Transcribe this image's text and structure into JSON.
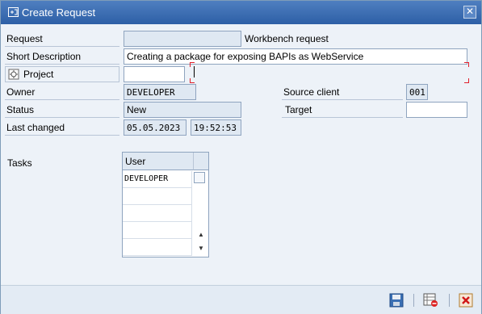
{
  "window": {
    "title": "Create Request",
    "close_label": "✕"
  },
  "form": {
    "request_label": "Request",
    "request_value": "",
    "request_type": "Workbench request",
    "short_desc_label": "Short Description",
    "short_desc_value": "Creating a package for exposing BAPIs as WebService",
    "project_label": "Project",
    "project_value": "",
    "owner_label": "Owner",
    "owner_value": "DEVELOPER",
    "status_label": "Status",
    "status_value": "New",
    "last_changed_label": "Last changed",
    "last_changed_date": "05.05.2023",
    "last_changed_time": "19:52:53",
    "source_client_label": "Source client",
    "source_client_value": "001",
    "target_label": "Target",
    "target_value": ""
  },
  "tasks": {
    "label": "Tasks",
    "column_header": "User",
    "rows": [
      "DEVELOPER",
      "",
      "",
      "",
      ""
    ],
    "scroll_up": "▲",
    "scroll_down": "▼"
  },
  "colors": {
    "title_bar": "#2d5fa6",
    "required_marker": "#e0202c"
  },
  "icons": {
    "title": "create-request-icon",
    "project": "project-icon",
    "save": "save-icon",
    "other": "table-delete-icon",
    "cancel": "cancel-icon"
  }
}
